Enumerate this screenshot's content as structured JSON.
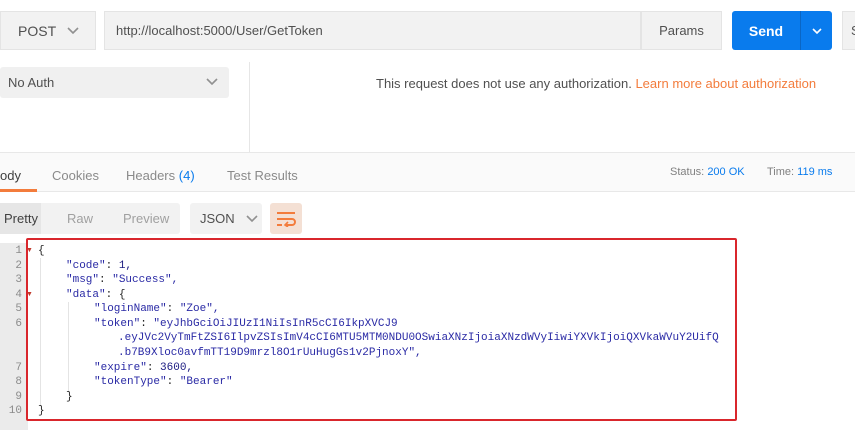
{
  "request": {
    "method": "POST",
    "url": "http://localhost:5000/User/GetToken",
    "params_label": "Params",
    "send_label": "Send",
    "save_label": "S"
  },
  "auth": {
    "type": "No Auth",
    "message": "This request does not use any authorization.",
    "link": "Learn more about authorization"
  },
  "response_tabs": {
    "body": "ody",
    "cookies": "Cookies",
    "headers": "Headers",
    "headers_count": "(4)",
    "test_results": "Test Results"
  },
  "status": {
    "status_label": "Status:",
    "status_value": "200 OK",
    "time_label": "Time:",
    "time_value": "119 ms"
  },
  "format": {
    "pretty": "Pretty",
    "raw": "Raw",
    "preview": "Preview",
    "language": "JSON"
  },
  "code": {
    "line_numbers": [
      "1",
      "2",
      "3",
      "4",
      "5",
      "6",
      "",
      "",
      "7",
      "8",
      "9",
      "10"
    ],
    "l1": "{",
    "l2_key": "\"code\"",
    "l2_val": "1,",
    "l3_key": "\"msg\"",
    "l3_val": "\"Success\",",
    "l4_key": "\"data\"",
    "l4_val": "{",
    "l5_key": "\"loginName\"",
    "l5_val": "\"Zoe\",",
    "l6_key": "\"token\"",
    "l6_val": "\"eyJhbGciOiJIUzI1NiIsInR5cCI6IkpXVCJ9",
    "l6b": ".eyJVc2VyTmFtZSI6IlpvZSIsImV4cCI6MTU5MTM0NDU0OSwiaXNzIjoiaXNzdWVyIiwiYXVkIjoiQXVkaWVuY2UifQ",
    "l6c": ".b7B9Xloc0avfmTT19D9mrzl8O1rUuHugGs1v2PjnoxY\",",
    "l7_key": "\"expire\"",
    "l7_val": "3600,",
    "l8_key": "\"tokenType\"",
    "l8_val": "\"Bearer\"",
    "l9": "}",
    "l10": "}"
  },
  "colors": {
    "accent": "#f37c3c",
    "send": "#097bed",
    "highlight": "#d9262c"
  }
}
